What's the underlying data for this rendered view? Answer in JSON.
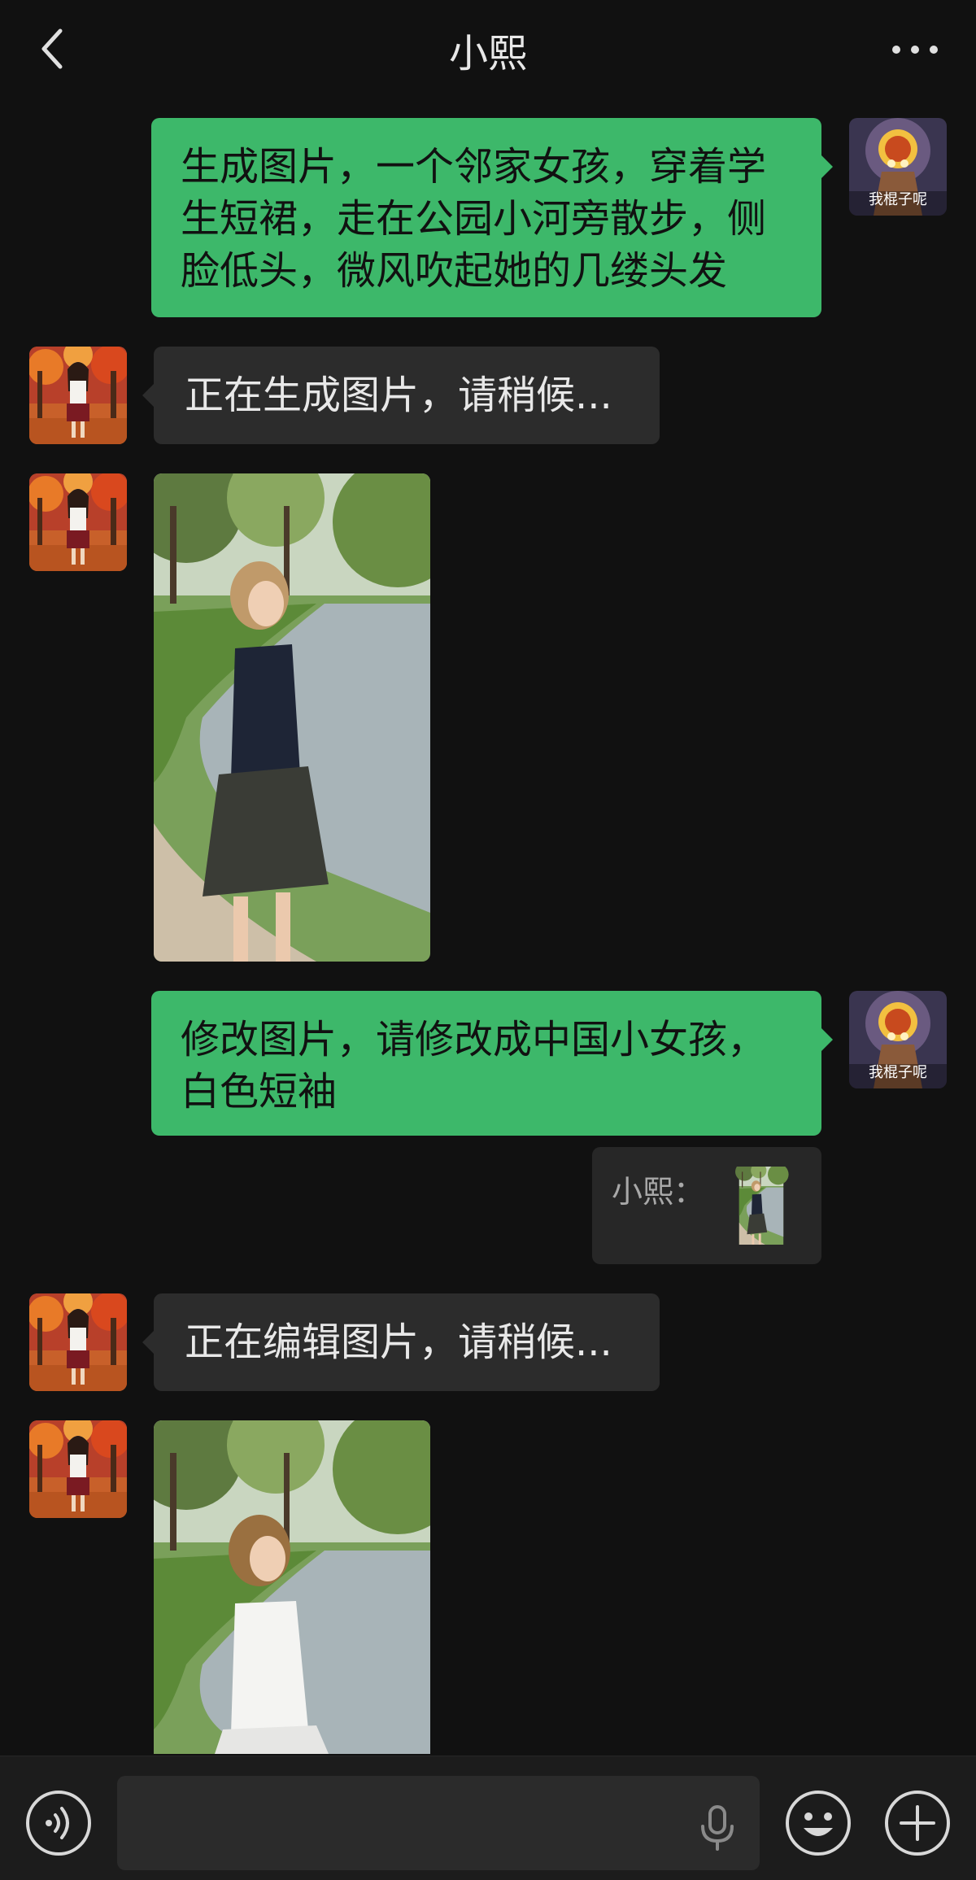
{
  "header": {
    "title": "小熙"
  },
  "messages": {
    "m1": {
      "line1": "生成图片，一个邻家女孩，穿着学",
      "line2": "生短裙，走在公园小河旁散步，侧",
      "line3": "脸低头，微风吹起她的几缕头发"
    },
    "m2": {
      "text": "正在生成图片，请稍候..."
    },
    "m4": {
      "line1": "修改图片，请修改成中国小女孩，",
      "line2": "白色短袖"
    },
    "m4_quote": {
      "label": "小熙："
    },
    "m5": {
      "text": "正在编辑图片，请稍候..."
    }
  },
  "user_avatar": {
    "caption": "我棍子呢"
  },
  "input": {
    "value": ""
  },
  "colors": {
    "background": "#111111",
    "outgoing_bubble": "#3db86a",
    "incoming_bubble": "#2c2c2c",
    "input_bar": "#1c1c1c"
  },
  "icons": {
    "back": "chevron-left-icon",
    "more": "more-dots-icon",
    "voice": "voice-icon",
    "mic": "mic-icon",
    "emoji": "emoji-icon",
    "plus": "plus-icon"
  }
}
